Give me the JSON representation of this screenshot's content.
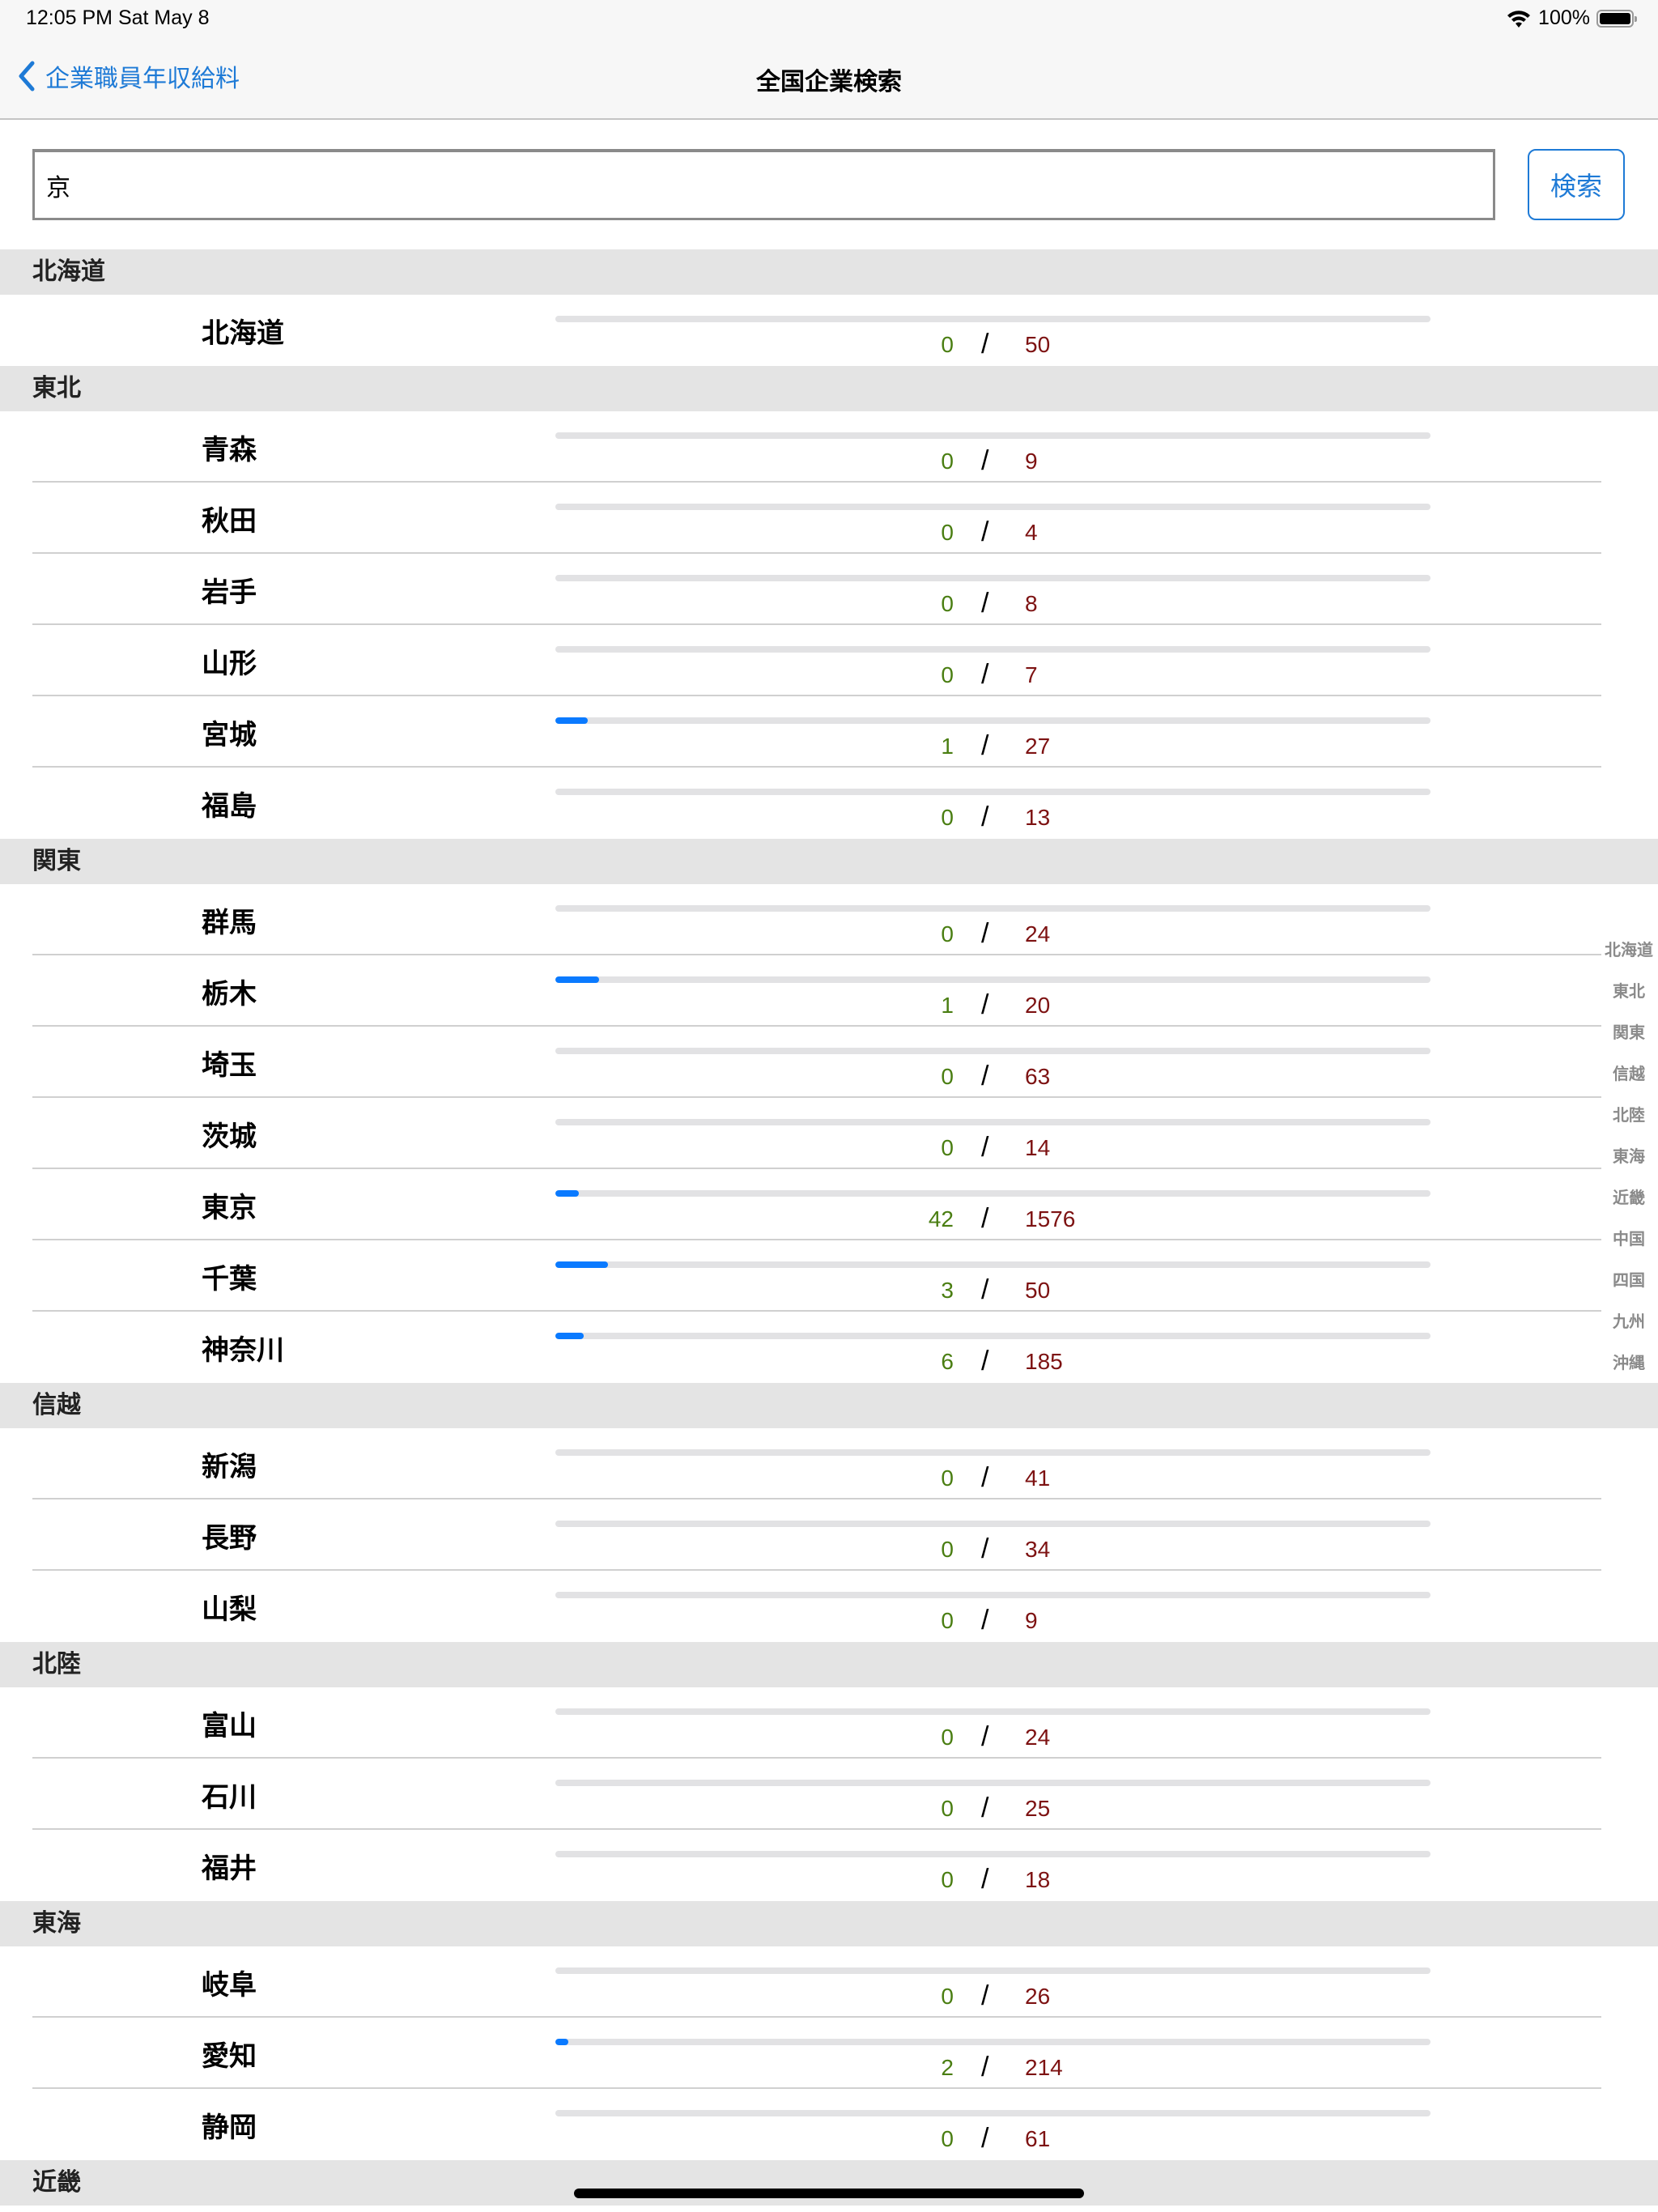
{
  "status_bar": {
    "time": "12:05 PM   Sat May 8",
    "battery": "100%",
    "icons": [
      "wifi-icon",
      "battery-icon"
    ]
  },
  "nav": {
    "back_label": "企業職員年収給料",
    "back_icon": "chevron-left-icon",
    "title": "全国企業検索"
  },
  "search": {
    "value": "京",
    "placeholder": "",
    "button_label": "検索"
  },
  "colors": {
    "accent": "#1e7ad6",
    "progress": "#0a7aff",
    "hit_count": "#4a7e12",
    "total_count": "#7d1212"
  },
  "sections": [
    {
      "title": "北海道",
      "rows": [
        {
          "name": "北海道",
          "hits": "0",
          "total": "50",
          "progress": 0
        }
      ]
    },
    {
      "title": "東北",
      "rows": [
        {
          "name": "青森",
          "hits": "0",
          "total": "9",
          "progress": 0
        },
        {
          "name": "秋田",
          "hits": "0",
          "total": "4",
          "progress": 0
        },
        {
          "name": "岩手",
          "hits": "0",
          "total": "8",
          "progress": 0
        },
        {
          "name": "山形",
          "hits": "0",
          "total": "7",
          "progress": 0
        },
        {
          "name": "宮城",
          "hits": "1",
          "total": "27",
          "progress": 0.037
        },
        {
          "name": "福島",
          "hits": "0",
          "total": "13",
          "progress": 0
        }
      ]
    },
    {
      "title": "関東",
      "rows": [
        {
          "name": "群馬",
          "hits": "0",
          "total": "24",
          "progress": 0
        },
        {
          "name": "栃木",
          "hits": "1",
          "total": "20",
          "progress": 0.05
        },
        {
          "name": "埼玉",
          "hits": "0",
          "total": "63",
          "progress": 0
        },
        {
          "name": "茨城",
          "hits": "0",
          "total": "14",
          "progress": 0
        },
        {
          "name": "東京",
          "hits": "42",
          "total": "1576",
          "progress": 0.027
        },
        {
          "name": "千葉",
          "hits": "3",
          "total": "50",
          "progress": 0.06
        },
        {
          "name": "神奈川",
          "hits": "6",
          "total": "185",
          "progress": 0.032
        }
      ]
    },
    {
      "title": "信越",
      "rows": [
        {
          "name": "新潟",
          "hits": "0",
          "total": "41",
          "progress": 0
        },
        {
          "name": "長野",
          "hits": "0",
          "total": "34",
          "progress": 0
        },
        {
          "name": "山梨",
          "hits": "0",
          "total": "9",
          "progress": 0
        }
      ]
    },
    {
      "title": "北陸",
      "rows": [
        {
          "name": "富山",
          "hits": "0",
          "total": "24",
          "progress": 0
        },
        {
          "name": "石川",
          "hits": "0",
          "total": "25",
          "progress": 0
        },
        {
          "name": "福井",
          "hits": "0",
          "total": "18",
          "progress": 0
        }
      ]
    },
    {
      "title": "東海",
      "rows": [
        {
          "name": "岐阜",
          "hits": "0",
          "total": "26",
          "progress": 0
        },
        {
          "name": "愛知",
          "hits": "2",
          "total": "214",
          "progress": 0.009
        },
        {
          "name": "静岡",
          "hits": "0",
          "total": "61",
          "progress": 0
        }
      ]
    },
    {
      "title": "近畿",
      "rows": []
    }
  ],
  "section_index": [
    "北海道",
    "東北",
    "関東",
    "信越",
    "北陸",
    "東海",
    "近畿",
    "中国",
    "四国",
    "九州",
    "沖縄"
  ]
}
